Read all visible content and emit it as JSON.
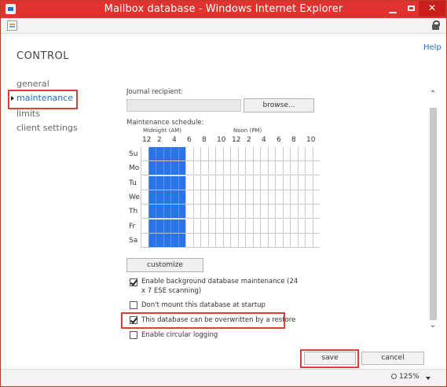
{
  "window": {
    "title": "Mailbox database - Windows Internet Explorer"
  },
  "header": {
    "title": "CONTROL",
    "help": "Help"
  },
  "nav": {
    "items": [
      "general",
      "maintenance",
      "limits",
      "client settings"
    ],
    "active": "maintenance"
  },
  "journal": {
    "label": "Journal recipient:",
    "value": "",
    "browse": "browse..."
  },
  "schedule": {
    "label": "Maintenance schedule:",
    "midnight_label": "Midnight (AM)",
    "noon_label": "Noon (PM)",
    "hours": [
      "12",
      "2",
      "4",
      "6",
      "8",
      "10",
      "12",
      "2",
      "4",
      "6",
      "8",
      "10"
    ],
    "days": [
      "Su",
      "Mo",
      "Tu",
      "We",
      "Th",
      "Fr",
      "Sa"
    ],
    "selected_hours": [
      1,
      5
    ]
  },
  "customize": "customize",
  "options": [
    {
      "label": "Enable background database maintenance (24 x 7 ESE scanning)",
      "checked": true
    },
    {
      "label": "Don't mount this database at startup",
      "checked": false
    },
    {
      "label": "This database can be overwritten by a restore",
      "checked": true
    },
    {
      "label": "Enable circular logging",
      "checked": false
    }
  ],
  "footer": {
    "save": "save",
    "cancel": "cancel"
  },
  "status": {
    "zoom": "125%"
  },
  "colors": {
    "titlebar": "#e0322f",
    "highlight": "#d9413a",
    "schedule_on": "#2a74e8",
    "link": "#1a6fc4"
  }
}
